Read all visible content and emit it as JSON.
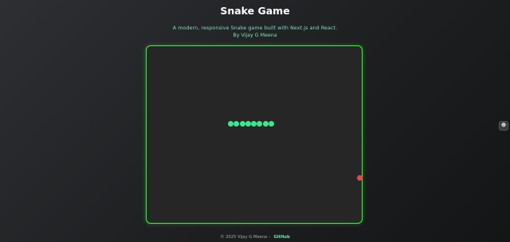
{
  "header": {
    "title": "Snake Game",
    "subtitle": "A modern, responsive Snake game built with Next.js and React.",
    "author": "By Vijay G Meena"
  },
  "game": {
    "snake_length": 8,
    "snake_direction": "right",
    "colors": {
      "board_border": "#2bff2b",
      "board_background": "#262627",
      "snake": "#3ee68f",
      "food": "#e5484d"
    }
  },
  "side_button": {
    "icon": "chat-bot-icon"
  },
  "footer": {
    "copyright": "© 2025 Vijay G Meena –",
    "github_label": "GitHub"
  }
}
